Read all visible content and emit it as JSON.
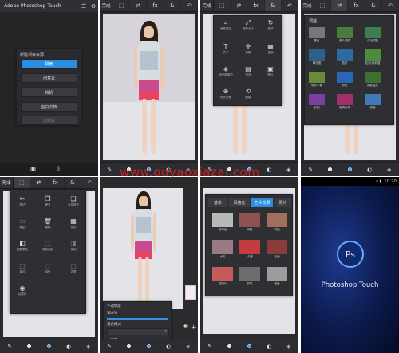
{
  "panel1": {
    "app_title": "Adobe Photoshop Touch",
    "dialog_title": "新建项目来源",
    "options": [
      "相册",
      "创意云",
      "相机",
      "空白文档",
      "剪贴板"
    ],
    "selected_option": "相册"
  },
  "editor": {
    "done_label": "完成",
    "fx_label": "fx",
    "brush_size_label": "",
    "tools_label": "",
    "layers_label": ""
  },
  "tools_popup": {
    "items": [
      "画框选区",
      "图像大小",
      "旋转",
      "文本",
      "变换",
      "扭曲",
      "填充和描边",
      "渐变",
      "照片",
      "镜头光晕",
      "刷新"
    ]
  },
  "adjust_popup": {
    "title": "调整",
    "items": [
      "黑白",
      "照片滤镜",
      "自动调整",
      "曝光度",
      "色阶",
      "色相/饱和度",
      "色彩平衡",
      "颜色",
      "阴影高光",
      "反相",
      "色调分离",
      "阈值"
    ]
  },
  "panel5": {
    "items": [
      "剪切",
      "拷贝",
      "合并拷贝",
      "粘贴",
      "删除",
      "变形",
      "图层蒙版",
      "清除选区",
      "反相",
      "描边",
      "羽化",
      "边框",
      "从照片"
    ]
  },
  "panel6": {
    "opacity_label": "不透明度",
    "opacity_value": "100%",
    "blend_label": "混合模式",
    "blend_value": "正常"
  },
  "panel7": {
    "tabs": [
      "基本",
      "风格化",
      "艺术效果",
      "照片"
    ],
    "active_tab": "艺术效果",
    "items": [
      "铅笔画",
      "海报",
      "剪贴",
      "水彩",
      "卡通",
      "油画",
      "旧照片",
      "炭笔",
      "漫画"
    ]
  },
  "panel8": {
    "status_time": "10:20",
    "logo_text": "Ps",
    "app_name": "Photoshop Touch"
  },
  "watermark": "www.ouyaoxiazai.com"
}
